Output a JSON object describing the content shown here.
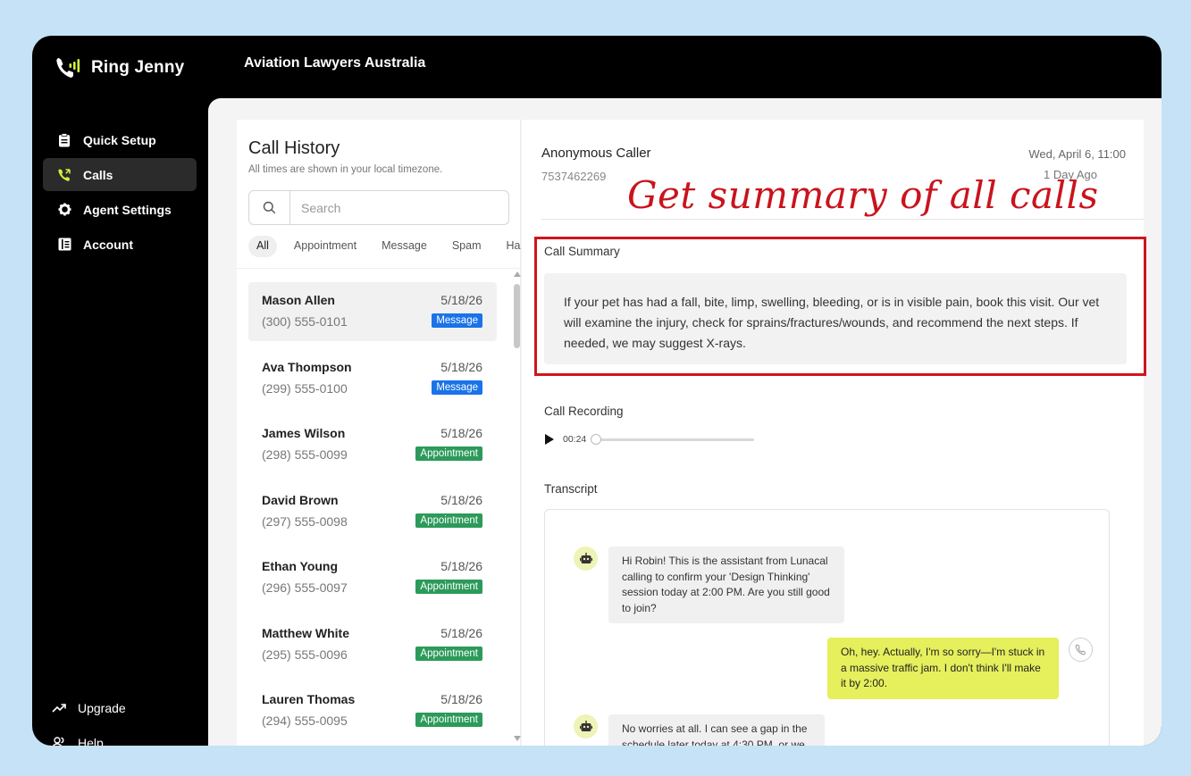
{
  "brand": {
    "name": "Ring Jenny",
    "accent": "#d7ef3e"
  },
  "org": {
    "name": "Aviation Lawyers Australia"
  },
  "nav": {
    "items": [
      {
        "label": "Quick Setup",
        "icon": "clipboard-icon"
      },
      {
        "label": "Calls",
        "icon": "phone-icon"
      },
      {
        "label": "Agent Settings",
        "icon": "gear-icon"
      },
      {
        "label": "Account",
        "icon": "book-icon"
      }
    ],
    "active": "Calls",
    "bottom": [
      {
        "label": "Upgrade",
        "icon": "trending-up-icon"
      },
      {
        "label": "Help",
        "icon": "users-icon"
      }
    ]
  },
  "history": {
    "title": "Call History",
    "subtitle": "All times are shown in your local timezone.",
    "search_placeholder": "Search",
    "filters": [
      "All",
      "Appointment",
      "Message",
      "Spam",
      "Ha"
    ],
    "active_filter": "All",
    "calls": [
      {
        "name": "Mason Allen",
        "phone": "(300) 555-0101",
        "date": "5/18/26",
        "tag": "Message"
      },
      {
        "name": "Ava Thompson",
        "phone": "(299) 555-0100",
        "date": "5/18/26",
        "tag": "Message"
      },
      {
        "name": "James Wilson",
        "phone": "(298) 555-0099",
        "date": "5/18/26",
        "tag": "Appointment"
      },
      {
        "name": "David Brown",
        "phone": "(297) 555-0098",
        "date": "5/18/26",
        "tag": "Appointment"
      },
      {
        "name": "Ethan Young",
        "phone": "(296) 555-0097",
        "date": "5/18/26",
        "tag": "Appointment"
      },
      {
        "name": "Matthew White",
        "phone": "(295) 555-0096",
        "date": "5/18/26",
        "tag": "Appointment"
      },
      {
        "name": "Lauren Thomas",
        "phone": "(294) 555-0095",
        "date": "5/18/26",
        "tag": "Appointment"
      }
    ]
  },
  "detail": {
    "caller_name": "Anonymous Caller",
    "caller_phone": "7537462269",
    "when": "Wed, April 6, 11:00",
    "ago": "1 Day Ago",
    "annotation": "Get summary of all calls",
    "summary_title": "Call Summary",
    "summary_text": "If your pet has had a fall, bite, limp, swelling, bleeding, or is in visible pain, book this visit. Our vet will examine the injury, check for sprains/fractures/wounds, and recommend the next steps. If needed, we may suggest X-rays.",
    "recording_title": "Call Recording",
    "recording_time": "00:24",
    "recording_progress": 0,
    "transcript_title": "Transcript",
    "transcript": [
      {
        "speaker": "bot",
        "text": "Hi Robin! This is the assistant from Lunacal calling to confirm your 'Design Thinking' session today at 2:00 PM. Are you still good to join?"
      },
      {
        "speaker": "user",
        "text": "Oh, hey. Actually, I'm so sorry—I'm stuck in a massive traffic jam. I don't think I'll make it by 2:00."
      },
      {
        "speaker": "bot",
        "text": "No worries at all. I can see a gap in the schedule later today at 4:30 PM, or we"
      }
    ]
  },
  "colors": {
    "message_badge": "#1a73e8",
    "appointment_badge": "#2c9a5a",
    "highlight": "#d0151d",
    "user_bubble": "#e6ef5c"
  }
}
